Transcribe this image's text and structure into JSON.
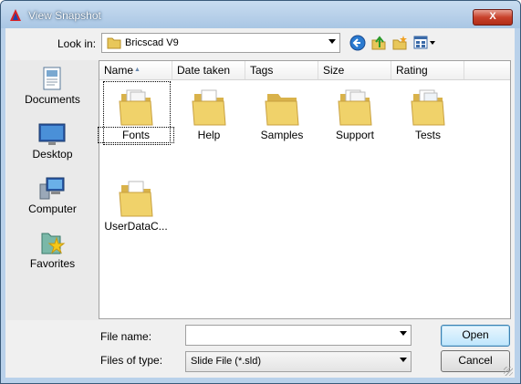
{
  "window": {
    "title": "View Snapshot",
    "close_label": "X"
  },
  "lookin": {
    "label": "Look in:",
    "value": "Bricscad V9"
  },
  "toolbar": {
    "back_icon": "back-arrow-icon",
    "up_icon": "up-folder-icon",
    "new_icon": "new-folder-icon",
    "views_icon": "views-menu-icon"
  },
  "places": [
    {
      "label": "Documents",
      "icon": "documents-icon"
    },
    {
      "label": "Desktop",
      "icon": "desktop-icon"
    },
    {
      "label": "Computer",
      "icon": "computer-icon"
    },
    {
      "label": "Favorites",
      "icon": "favorites-icon"
    }
  ],
  "columns": [
    "Name",
    "Date taken",
    "Tags",
    "Size",
    "Rating"
  ],
  "files": [
    {
      "name": "Fonts",
      "selected": true
    },
    {
      "name": "Help"
    },
    {
      "name": "Samples"
    },
    {
      "name": "Support"
    },
    {
      "name": "Tests"
    },
    {
      "name": "UserDataC..."
    }
  ],
  "filename": {
    "label": "File name:",
    "value": ""
  },
  "filetype": {
    "label": "Files of type:",
    "value": "Slide File (*.sld)"
  },
  "buttons": {
    "open": "Open",
    "cancel": "Cancel"
  }
}
